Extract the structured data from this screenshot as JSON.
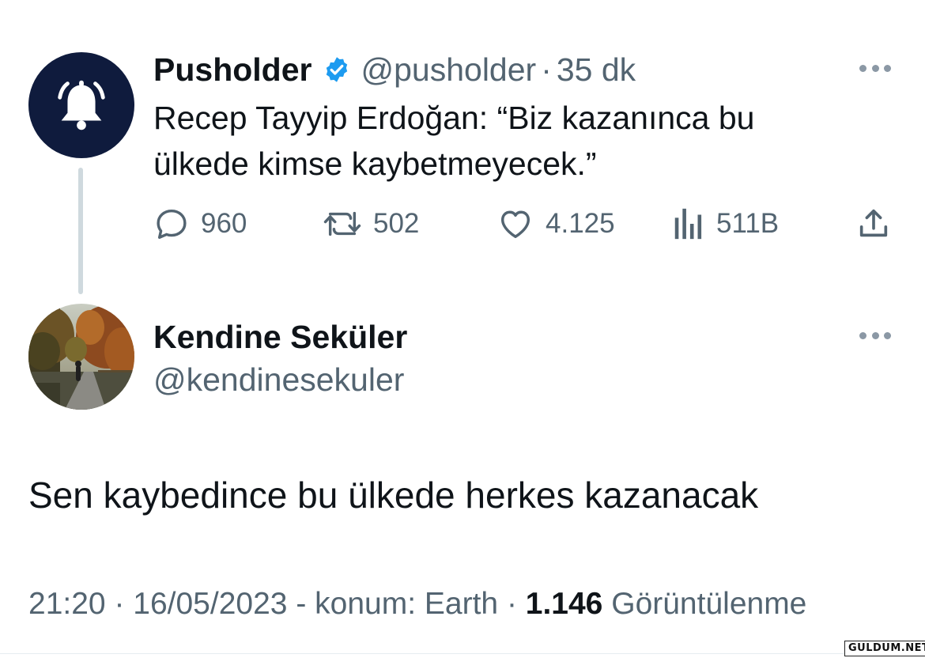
{
  "parent_tweet": {
    "author_name": "Pusholder",
    "handle": "@pusholder",
    "separator": "·",
    "time_ago": "35 dk",
    "verified_color": "#1d9bf0",
    "avatar_icon": "bell-icon",
    "text": "Recep Tayyip Erdoğan: “Biz kazanınca bu\nülkede kimse kaybetmeyecek.”",
    "metrics": {
      "replies": "960",
      "retweets": "502",
      "likes": "4.125",
      "views": "511B"
    }
  },
  "reply_tweet": {
    "author_name": "Kendine Seküler",
    "handle": "@kendinesekuler",
    "text": "Sen kaybedince bu ülkede herkes kazanacak",
    "time": "21:20",
    "date": "16/05/2023",
    "location": "konum: Earth",
    "views_count": "1.146",
    "views_label": "Görüntülenme"
  },
  "watermark": "GULDUM.NET",
  "colors": {
    "text_primary": "#0f1419",
    "text_secondary": "#536471",
    "bell_avatar_bg": "#0f1b3d",
    "thread_line": "#cfd9de"
  }
}
